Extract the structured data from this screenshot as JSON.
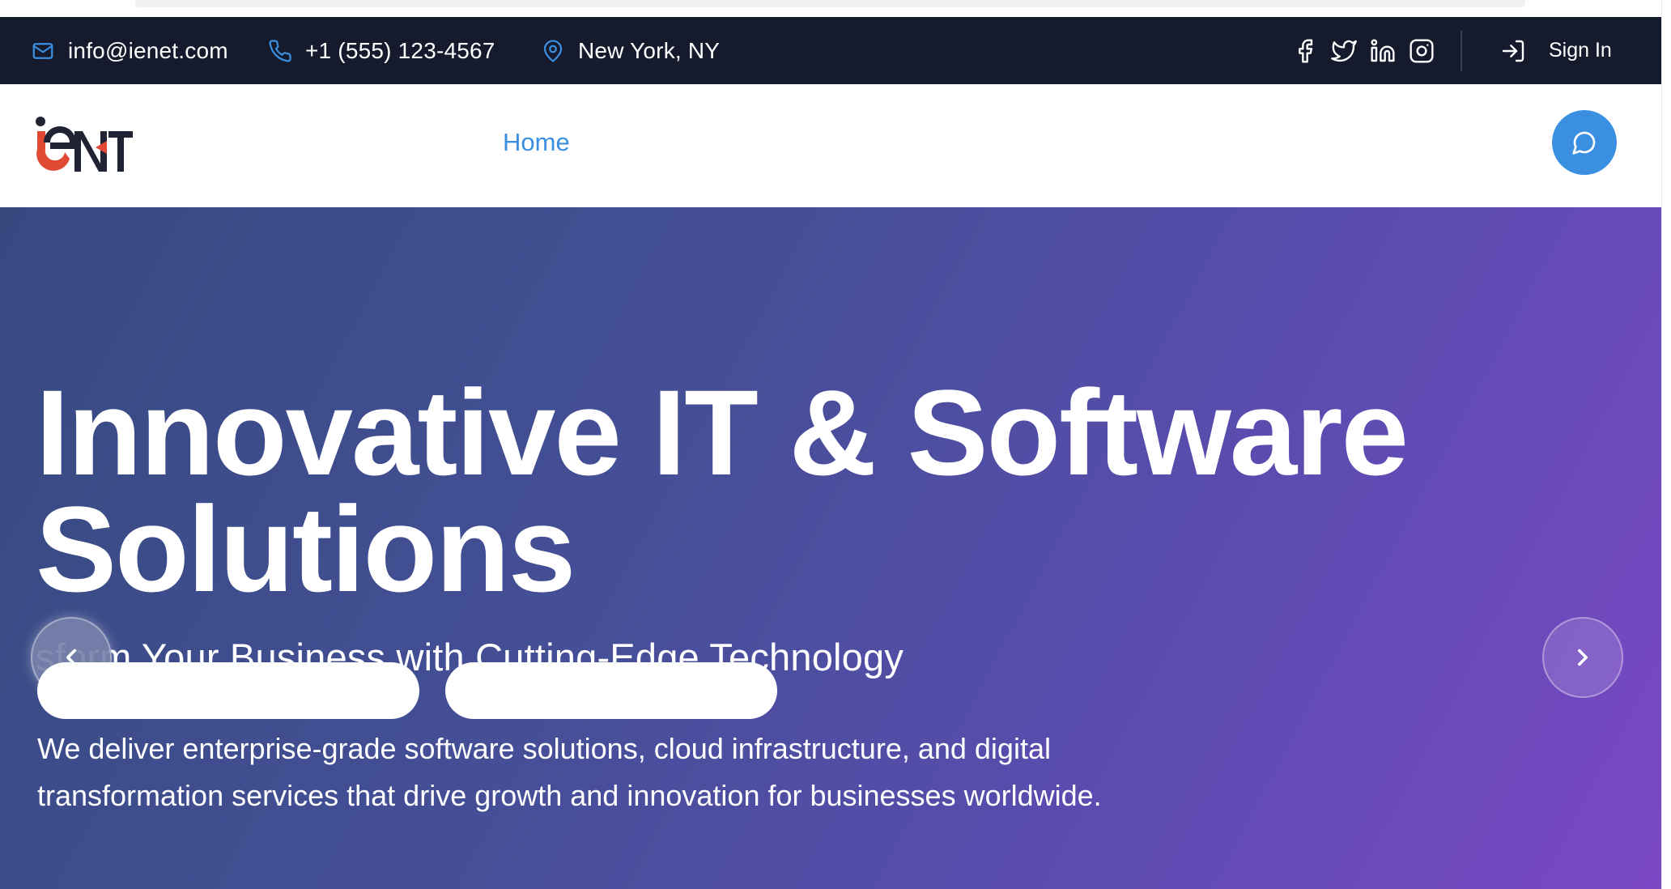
{
  "topbar": {
    "email": "info@ienet.com",
    "phone": "+1 (555) 123-4567",
    "location": "New York, NY",
    "socials": [
      "facebook-icon",
      "twitter-icon",
      "linkedin-icon",
      "instagram-icon"
    ],
    "signin_label": "Sign In"
  },
  "navbar": {
    "logo_text": "ieNT",
    "links": [
      {
        "label": "Home",
        "active": true
      }
    ]
  },
  "hero": {
    "title": "Innovative IT & Software Solutions",
    "subtitle": "sform Your Business with Cutting-Edge Technology",
    "description": "We deliver enterprise-grade software solutions, cloud infrastructure, and digital transformation services that drive growth and innovation for businesses worldwide."
  },
  "colors": {
    "topbar_bg": "#151a2d",
    "accent": "#3b8fe0",
    "hero_gradient_start": "#364a80",
    "hero_gradient_end": "#7b48c4",
    "logo_red": "#e04a34",
    "logo_dark": "#1f2333"
  }
}
